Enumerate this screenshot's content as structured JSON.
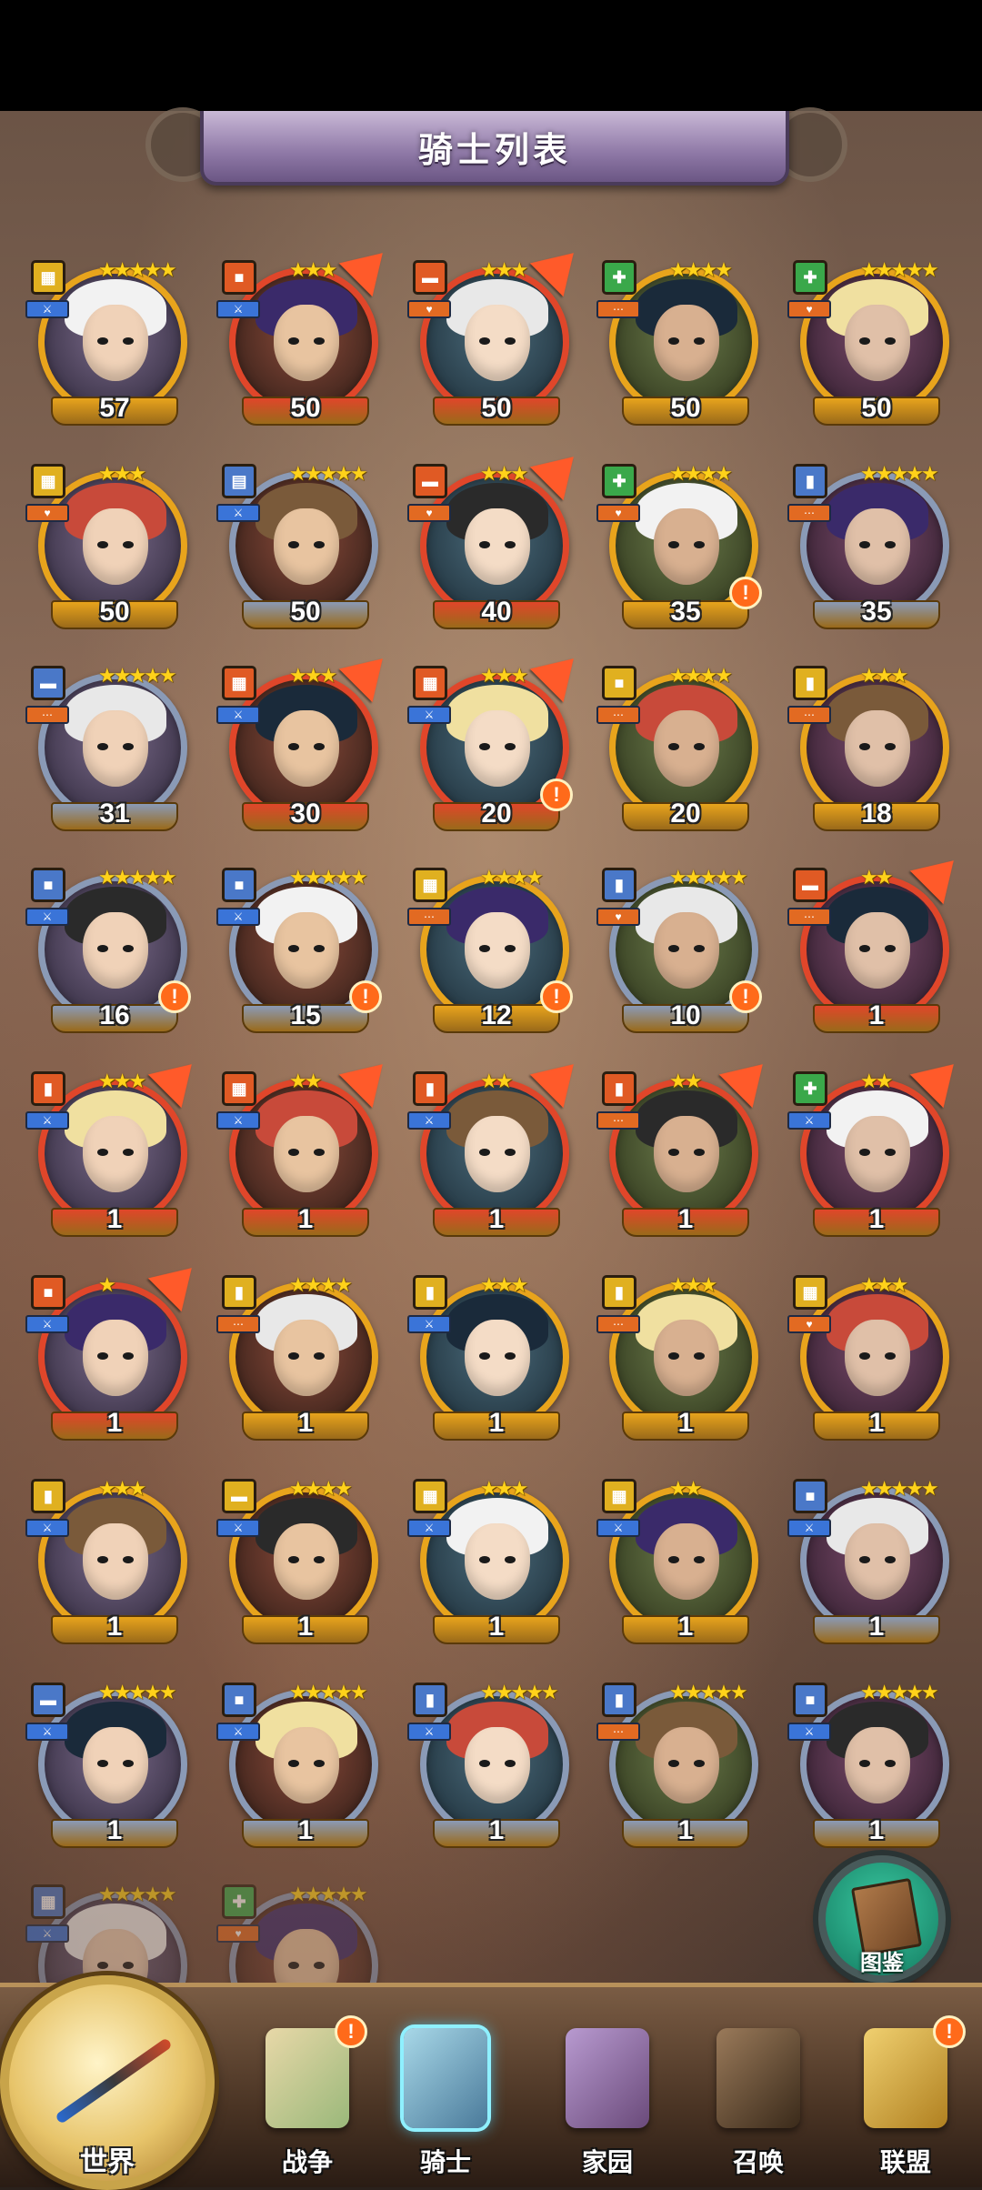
{
  "header": {
    "title": "骑士列表"
  },
  "knights": [
    {
      "level": "57",
      "stars": "★★★★★",
      "role": "▦",
      "class": "⚔",
      "frame": "gold",
      "upgrade": false,
      "alert": false
    },
    {
      "level": "50",
      "stars": "★★★",
      "role": "■",
      "class": "⚔",
      "frame": "red",
      "upgrade": true,
      "alert": false
    },
    {
      "level": "50",
      "stars": "★★★",
      "role": "▬",
      "class": "♥",
      "frame": "red",
      "upgrade": true,
      "alert": false
    },
    {
      "level": "50",
      "stars": "★★★★",
      "role": "✚",
      "class": "⋯",
      "frame": "gold",
      "upgrade": false,
      "alert": false
    },
    {
      "level": "50",
      "stars": "★★★★★",
      "role": "✚",
      "class": "♥",
      "frame": "gold",
      "upgrade": false,
      "alert": false
    },
    {
      "level": "50",
      "stars": "★★★",
      "role": "▦",
      "class": "♥",
      "frame": "gold",
      "upgrade": false,
      "alert": false
    },
    {
      "level": "50",
      "stars": "★★★★★",
      "role": "▤",
      "class": "⚔",
      "frame": "blue",
      "upgrade": false,
      "alert": false
    },
    {
      "level": "40",
      "stars": "★★★",
      "role": "▬",
      "class": "♥",
      "frame": "red",
      "upgrade": true,
      "alert": false
    },
    {
      "level": "35",
      "stars": "★★★★",
      "role": "✚",
      "class": "♥",
      "frame": "gold",
      "upgrade": false,
      "alert": true
    },
    {
      "level": "35",
      "stars": "★★★★★",
      "role": "▮",
      "class": "⋯",
      "frame": "blue",
      "upgrade": false,
      "alert": false
    },
    {
      "level": "31",
      "stars": "★★★★★",
      "role": "▬",
      "class": "⋯",
      "frame": "blue",
      "upgrade": false,
      "alert": false
    },
    {
      "level": "30",
      "stars": "★★★",
      "role": "▦",
      "class": "⚔",
      "frame": "red",
      "upgrade": true,
      "alert": false
    },
    {
      "level": "20",
      "stars": "★★★",
      "role": "▦",
      "class": "⚔",
      "frame": "red",
      "upgrade": true,
      "alert": true
    },
    {
      "level": "20",
      "stars": "★★★★",
      "role": "■",
      "class": "⋯",
      "frame": "gold",
      "upgrade": false,
      "alert": false
    },
    {
      "level": "18",
      "stars": "★★★",
      "role": "▮",
      "class": "⋯",
      "frame": "gold",
      "upgrade": false,
      "alert": false
    },
    {
      "level": "16",
      "stars": "★★★★★",
      "role": "■",
      "class": "⚔",
      "frame": "blue",
      "upgrade": false,
      "alert": true
    },
    {
      "level": "15",
      "stars": "★★★★★",
      "role": "■",
      "class": "⚔",
      "frame": "blue",
      "upgrade": false,
      "alert": true
    },
    {
      "level": "12",
      "stars": "★★★★",
      "role": "▦",
      "class": "⋯",
      "frame": "gold",
      "upgrade": false,
      "alert": true
    },
    {
      "level": "10",
      "stars": "★★★★★",
      "role": "▮",
      "class": "♥",
      "frame": "blue",
      "upgrade": false,
      "alert": true
    },
    {
      "level": "1",
      "stars": "★★",
      "role": "▬",
      "class": "⋯",
      "frame": "red",
      "upgrade": true,
      "alert": false
    },
    {
      "level": "1",
      "stars": "★★★",
      "role": "▮",
      "class": "⚔",
      "frame": "red",
      "upgrade": true,
      "alert": false
    },
    {
      "level": "1",
      "stars": "★★",
      "role": "▦",
      "class": "⚔",
      "frame": "red",
      "upgrade": true,
      "alert": false
    },
    {
      "level": "1",
      "stars": "★★",
      "role": "▮",
      "class": "⚔",
      "frame": "red",
      "upgrade": true,
      "alert": false
    },
    {
      "level": "1",
      "stars": "★★",
      "role": "▮",
      "class": "⋯",
      "frame": "red",
      "upgrade": true,
      "alert": false
    },
    {
      "level": "1",
      "stars": "★★",
      "role": "✚",
      "class": "⚔",
      "frame": "red",
      "upgrade": true,
      "alert": false
    },
    {
      "level": "1",
      "stars": "★",
      "role": "■",
      "class": "⚔",
      "frame": "red",
      "upgrade": true,
      "alert": false
    },
    {
      "level": "1",
      "stars": "★★★★",
      "role": "▮",
      "class": "⋯",
      "frame": "gold",
      "upgrade": false,
      "alert": false
    },
    {
      "level": "1",
      "stars": "★★★",
      "role": "▮",
      "class": "⚔",
      "frame": "gold",
      "upgrade": false,
      "alert": false
    },
    {
      "level": "1",
      "stars": "★★★",
      "role": "▮",
      "class": "⋯",
      "frame": "gold",
      "upgrade": false,
      "alert": false
    },
    {
      "level": "1",
      "stars": "★★★",
      "role": "▦",
      "class": "♥",
      "frame": "gold",
      "upgrade": false,
      "alert": false
    },
    {
      "level": "1",
      "stars": "★★★",
      "role": "▮",
      "class": "⚔",
      "frame": "gold",
      "upgrade": false,
      "alert": false
    },
    {
      "level": "1",
      "stars": "★★★★",
      "role": "▬",
      "class": "⚔",
      "frame": "gold",
      "upgrade": false,
      "alert": false
    },
    {
      "level": "1",
      "stars": "★★★",
      "role": "▦",
      "class": "⚔",
      "frame": "gold",
      "upgrade": false,
      "alert": false
    },
    {
      "level": "1",
      "stars": "★★",
      "role": "▦",
      "class": "⚔",
      "frame": "gold",
      "upgrade": false,
      "alert": false
    },
    {
      "level": "1",
      "stars": "★★★★★",
      "role": "■",
      "class": "⚔",
      "frame": "blue",
      "upgrade": false,
      "alert": false
    },
    {
      "level": "1",
      "stars": "★★★★★",
      "role": "▬",
      "class": "⚔",
      "frame": "blue",
      "upgrade": false,
      "alert": false
    },
    {
      "level": "1",
      "stars": "★★★★★",
      "role": "■",
      "class": "⚔",
      "frame": "blue",
      "upgrade": false,
      "alert": false
    },
    {
      "level": "1",
      "stars": "★★★★★",
      "role": "▮",
      "class": "⚔",
      "frame": "blue",
      "upgrade": false,
      "alert": false
    },
    {
      "level": "1",
      "stars": "★★★★★",
      "role": "▮",
      "class": "⋯",
      "frame": "blue",
      "upgrade": false,
      "alert": false
    },
    {
      "level": "1",
      "stars": "★★★★★",
      "role": "■",
      "class": "⚔",
      "frame": "blue",
      "upgrade": false,
      "alert": false
    },
    {
      "level": "",
      "stars": "★★★★★",
      "role": "▦",
      "class": "⚔",
      "frame": "blue",
      "upgrade": false,
      "alert": false
    },
    {
      "level": "",
      "stars": "★★★★★",
      "role": "✚",
      "class": "♥",
      "frame": "blue",
      "upgrade": false,
      "alert": false
    }
  ],
  "fab": {
    "label": "图鉴",
    "icon": "book-icon"
  },
  "nav": {
    "world": "世界",
    "items": [
      {
        "label": "战争",
        "icon": "map-icon",
        "active": false,
        "badge": "!"
      },
      {
        "label": "骑士",
        "icon": "knight-icon",
        "active": true,
        "badge": ""
      },
      {
        "label": "家园",
        "icon": "house-icon",
        "active": false,
        "badge": ""
      },
      {
        "label": "召唤",
        "icon": "train-icon",
        "active": false,
        "badge": ""
      },
      {
        "label": "联盟",
        "icon": "treasure-icon",
        "active": false,
        "badge": "!"
      }
    ]
  },
  "colors": {
    "gold": "#e8a41c",
    "red": "#e0462a",
    "blue": "#8a9ab6",
    "role_gold": "#e0b020",
    "role_red": "#e05a24",
    "role_blue": "#4a78c8",
    "role_green": "#3aa84a",
    "class_blue": "#3a74d8",
    "class_orange": "#e26a22"
  }
}
